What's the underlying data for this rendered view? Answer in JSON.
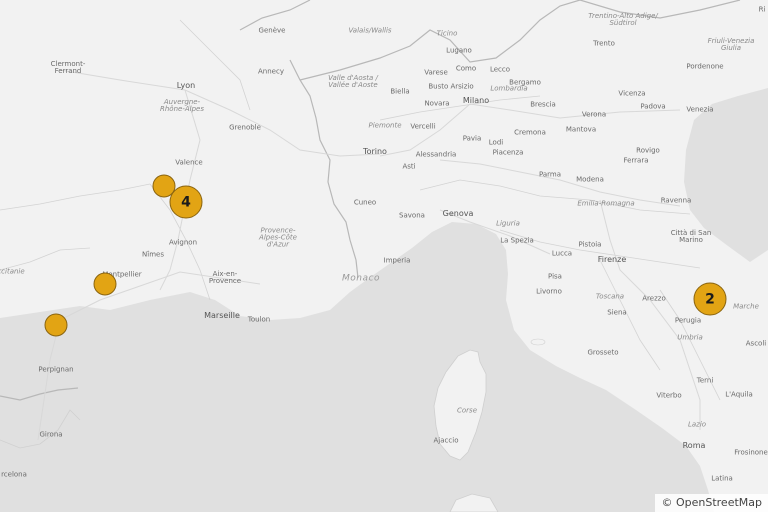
{
  "map": {
    "colors": {
      "land": "#f2f2f2",
      "sea": "#e0e0e0",
      "border": "#b8b8b8",
      "road": "#d6d6d6",
      "marker": "#e2a414",
      "marker_border": "#8a6410"
    },
    "markers": [
      {
        "id": "m1",
        "count": "",
        "kind": "single"
      },
      {
        "id": "m2",
        "count": "4",
        "kind": "cluster"
      },
      {
        "id": "m3",
        "count": "",
        "kind": "single"
      },
      {
        "id": "m4",
        "count": "",
        "kind": "single"
      },
      {
        "id": "m5",
        "count": "2",
        "kind": "cluster"
      }
    ],
    "labels": {
      "geneve": "Genève",
      "valais": "Valais/Wallis",
      "ticino": "Ticino",
      "trentino": "Trentino-Alto Adige/\nSüdtirol",
      "trento": "Trento",
      "friuli": "Friuli-Venezia\nGiulia",
      "clermont": "Clermont-\nFerrand",
      "lyon": "Lyon",
      "auvergne": "Auvergne-\nRhône-Alpes",
      "annecy": "Annecy",
      "aosta": "Valle d'Aosta /\nVallée d'Aoste",
      "lugano": "Lugano",
      "como": "Como",
      "lecco": "Lecco",
      "varese": "Varese",
      "busto": "Busto Arsizio",
      "bergamo": "Bergamo",
      "biella": "Biella",
      "lombardia": "Lombardia",
      "brescia": "Brescia",
      "vicenza": "Vicenza",
      "pordenone": "Pordenone",
      "novara": "Novara",
      "milano": "Milano",
      "verona": "Verona",
      "padova": "Padova",
      "venezia": "Venezia",
      "grenoble": "Grenoble",
      "piemonte": "Piemonte",
      "vercelli": "Vercelli",
      "pavia": "Pavia",
      "cremona": "Cremona",
      "mantova": "Mantova",
      "lodi": "Lodi",
      "rovigo": "Rovigo",
      "torino": "Torino",
      "alessandria": "Alessandria",
      "piacenza": "Piacenza",
      "ferrara": "Ferrara",
      "valence": "Valence",
      "asti": "Asti",
      "parma": "Parma",
      "modena": "Modena",
      "cuneo": "Cuneo",
      "savona": "Savona",
      "genova": "Genova",
      "ravenna": "Ravenna",
      "emilia": "Emilia-Romagna",
      "provence": "Provence-\nAlpes-Côte\nd'Azur",
      "avignon": "Avignon",
      "liguria": "Liguria",
      "laspezia": "La Spezia",
      "sanmarino": "Città di San\nMarino",
      "nimes": "Nîmes",
      "imperia": "Imperia",
      "pistoia": "Pistoia",
      "lucca": "Lucca",
      "firenze": "Firenze",
      "montpellier": "Montpellier",
      "aix": "Aix-en-\nProvence",
      "monaco": "Monaco",
      "pisa": "Pisa",
      "livorno": "Livorno",
      "toscana": "Toscana",
      "arezzo": "Arezzo",
      "marche": "Marche",
      "marseille": "Marseille",
      "toulon": "Toulon",
      "siena": "Siena",
      "perugia": "Perugia",
      "umbria": "Umbria",
      "ascoli": "Ascoli",
      "grosseto": "Grosseto",
      "perpignan": "Perpignan",
      "corse": "Corse",
      "terni": "Terni",
      "aquila": "L'Aquila",
      "viterbo": "Viterbo",
      "lazio": "Lazio",
      "ajaccio": "Ajaccio",
      "roma": "Roma",
      "frosinone": "Frosinone",
      "girona": "Girona",
      "latina": "Latina",
      "barcelona": "rcelona",
      "occitanie": "ccitanie",
      "riau": "Ri"
    }
  },
  "attribution": {
    "symbol": "©",
    "text": "OpenStreetMap"
  }
}
